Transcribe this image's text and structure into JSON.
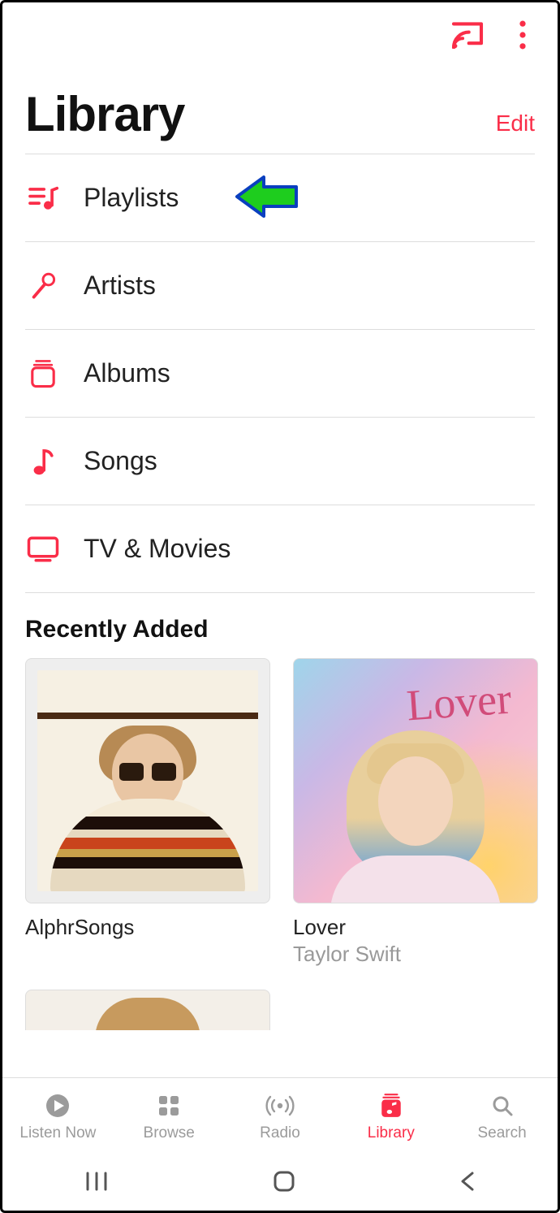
{
  "header": {
    "title": "Library",
    "edit_label": "Edit"
  },
  "categories": [
    {
      "label": "Playlists",
      "icon": "playlist"
    },
    {
      "label": "Artists",
      "icon": "mic"
    },
    {
      "label": "Albums",
      "icon": "album"
    },
    {
      "label": "Songs",
      "icon": "note"
    },
    {
      "label": "TV & Movies",
      "icon": "tv"
    }
  ],
  "recently_added": {
    "title": "Recently Added",
    "items": [
      {
        "title": "AlphrSongs",
        "subtitle": ""
      },
      {
        "title": "Lover",
        "subtitle": "Taylor Swift",
        "cover_text": "Lover"
      }
    ]
  },
  "tabs": [
    {
      "label": "Listen Now",
      "icon": "play",
      "active": false
    },
    {
      "label": "Browse",
      "icon": "grid",
      "active": false
    },
    {
      "label": "Radio",
      "icon": "radio",
      "active": false
    },
    {
      "label": "Library",
      "icon": "library",
      "active": true
    },
    {
      "label": "Search",
      "icon": "search",
      "active": false
    }
  ],
  "annotation": {
    "target_category_index": 0
  }
}
